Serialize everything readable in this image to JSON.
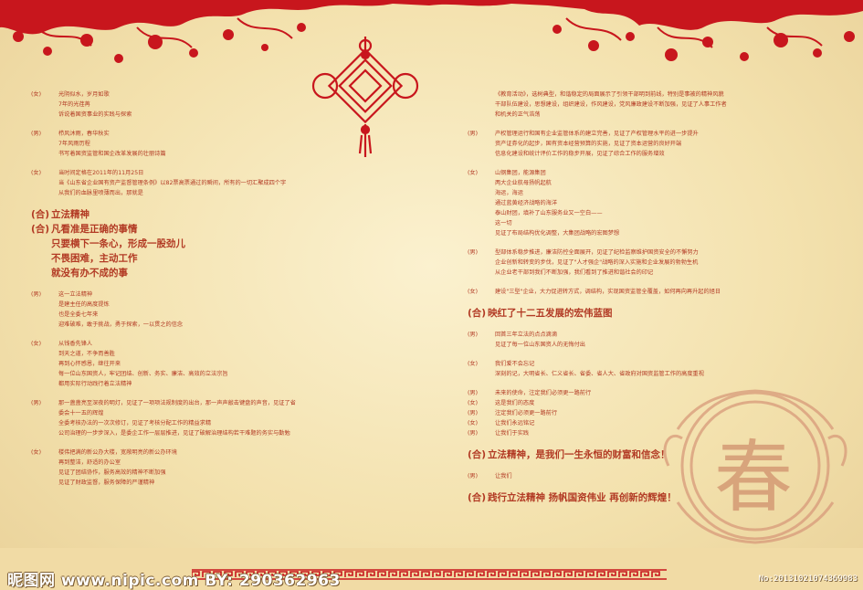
{
  "left_column": [
    {
      "lines": [
        {
          "role": "(女)",
          "text": "光阴似水，岁月如歌"
        },
        {
          "role": "",
          "text": "7年的光荏苒"
        },
        {
          "role": "",
          "text": "诉说着国资事业的实践与探索"
        }
      ]
    },
    {
      "lines": [
        {
          "role": "(男)",
          "text": "栉风沐雨，春华秋实"
        },
        {
          "role": "",
          "text": "7年风雨历程"
        },
        {
          "role": "",
          "text": "书写着国资监管和国企改革发展的壮丽诗篇"
        }
      ]
    },
    {
      "lines": [
        {
          "role": "(女)",
          "text": "当时间定格在2011年的11月25日"
        },
        {
          "role": "",
          "text": "当《山东省企业国有资产监督管理条例》以82票高票通过的瞬间，所有的一切汇聚成四个字"
        },
        {
          "role": "",
          "text": "从我们的血脉里喷薄而出，那就是"
        }
      ]
    },
    {
      "big": true,
      "lines": [
        {
          "role": "(合)",
          "text": "立法精神"
        },
        {
          "role": "(合)",
          "text": "凡看准是正确的事情"
        },
        {
          "role": "",
          "text": "只要横下一条心，形成一股劲儿"
        },
        {
          "role": "",
          "text": "不畏困难，主动工作"
        },
        {
          "role": "",
          "text": "就没有办不成的事"
        }
      ]
    },
    {
      "lines": [
        {
          "role": "(男)",
          "text": "这一立法精神"
        },
        {
          "role": "",
          "text": "是建主任的高度提炼"
        },
        {
          "role": "",
          "text": "也是全委七年来"
        },
        {
          "role": "",
          "text": "迎难破难，敢于挑战，勇于探索，一以贯之的信念"
        }
      ]
    },
    {
      "lines": [
        {
          "role": "(女)",
          "text": "从钱香先锋人"
        },
        {
          "role": "",
          "text": "到天之道，不争而善胜"
        },
        {
          "role": "",
          "text": "再到心怀感恩，继往开来"
        },
        {
          "role": "",
          "text": "每一位山东国资人，牢记团结、创新、务实、廉洁、高效的立法宗旨"
        },
        {
          "role": "",
          "text": "都用实际行动践行着立法精神"
        }
      ]
    },
    {
      "lines": [
        {
          "role": "(男)",
          "text": "那一盏盏亮至深夜的明灯，见证了一项项法规制度的出台，那一声声敲击键盘的声音，见证了省"
        },
        {
          "role": "",
          "text": "委会十一五的辉煌"
        },
        {
          "role": "",
          "text": "全委考核办法的一次次修订，见证了考核分配工作的精益求精"
        },
        {
          "role": "",
          "text": "公司治理的一步步深入，是委企工作一层层推进，见证了破解治理结构若干难题的务实与勤勉"
        }
      ]
    },
    {
      "lines": [
        {
          "role": "(女)",
          "text": "楼伟把满的新公办大楼，宽敞明亮的新公办环境"
        },
        {
          "role": "",
          "text": "再到整洁，舒适的办公室"
        },
        {
          "role": "",
          "text": "见证了团结协作，服务高效的精神不断加强"
        },
        {
          "role": "",
          "text": "见证了财政监督，服务保障的严谨精神"
        }
      ]
    }
  ],
  "right_column": [
    {
      "lines": [
        {
          "role": "",
          "text": "《教育活动》，选树典型，和谐稳定的局面展示了引领干部明到前线，特别是事被的精神风貌"
        },
        {
          "role": "",
          "text": "干部队伍建设，思想建设，组织建设，作风建设，党风廉政建设不断加强，见证了人事工作者"
        },
        {
          "role": "",
          "text": "和机关的正气浩荡"
        }
      ]
    },
    {
      "lines": [
        {
          "role": "(男)",
          "text": "产权管理运行和国有企业监管体系的建立完善，见证了产权管理水平的进一步提升"
        },
        {
          "role": "",
          "text": "资产证券化的起步，国有资本经营预算的实施，见证了资本运营的良好开端"
        },
        {
          "role": "",
          "text": "信息化建设和统计评价工作的稳步开展，见证了综合工作的服务增效"
        }
      ]
    },
    {
      "lines": [
        {
          "role": "(女)",
          "text": "山钢集团，能源集团"
        },
        {
          "role": "",
          "text": "两大企业航母扬帆起航"
        },
        {
          "role": "",
          "text": "海运，海运"
        },
        {
          "role": "",
          "text": "通过蓝黄经济战略的海洋"
        },
        {
          "role": "",
          "text": "泰山财团，填补了山东服务业又一空白——"
        },
        {
          "role": "",
          "text": "这一切"
        },
        {
          "role": "",
          "text": "见证了布局结构优化调整，大集团战略的宏图梦想"
        }
      ]
    },
    {
      "lines": [
        {
          "role": "(男)",
          "text": "型部体系稳步推进，廉洁防控全面展开，见证了纪检监察维护国资安全的不懈努力"
        },
        {
          "role": "",
          "text": "企业创新和转变的步伐，见证了\"人才强企\"战略的深入实施和企业发展的勃勃生机"
        },
        {
          "role": "",
          "text": "从企业老干部到我们不断加强，我们看到了推进和谐社会的印记"
        }
      ]
    },
    {
      "lines": [
        {
          "role": "(女)",
          "text": "建设\"三型\"企业，大力促进转方式，调结构，实现国资监管全覆盖，如何再向再升起的旭日"
        }
      ]
    },
    {
      "big": true,
      "lines": [
        {
          "role": "(合)",
          "text": "映红了十二五发展的宏伟蓝图"
        }
      ]
    },
    {
      "lines": [
        {
          "role": "(男)",
          "text": "回首三年立法的点点滴滴"
        },
        {
          "role": "",
          "text": "见证了每一位山东国资人的无悔付出"
        }
      ]
    },
    {
      "lines": [
        {
          "role": "(女)",
          "text": "我们爱不会忘记"
        },
        {
          "role": "",
          "text": "深刻的记，大明省长、仁义省长、省委、省人大、省政府对国资监管工作的高度重视"
        }
      ]
    },
    {
      "lines": [
        {
          "role": "(男)",
          "text": "未来的使命，注定我们必须更一路前行"
        },
        {
          "role": "(女)",
          "text": "这是我们的态度"
        },
        {
          "role": "(男)",
          "text": "注定我们必须更一路前行"
        },
        {
          "role": "(女)",
          "text": "让我们永远铭记"
        },
        {
          "role": "(男)",
          "text": "让我们于实践"
        }
      ]
    },
    {
      "big": true,
      "lines": [
        {
          "role": "(合)",
          "text": "立法精神，是我们一生永恒的财富和信念！"
        }
      ]
    },
    {
      "lines": [
        {
          "role": "(男)",
          "text": "让我们"
        }
      ]
    },
    {
      "big": true,
      "lines": [
        {
          "role": "(合)",
          "text": "践行立法精神 扬帆国资伟业 再创新的辉煌！"
        }
      ]
    }
  ],
  "medallion": {
    "character": "春"
  },
  "watermark": {
    "logo": "昵图网",
    "url": "www.nipic.com",
    "by": "BY:",
    "id": "290362963"
  },
  "image_id": "No:20131021074369983",
  "colors": {
    "red": "#c8161d",
    "text": "#b23a24",
    "paper": "#f6e7bb"
  }
}
